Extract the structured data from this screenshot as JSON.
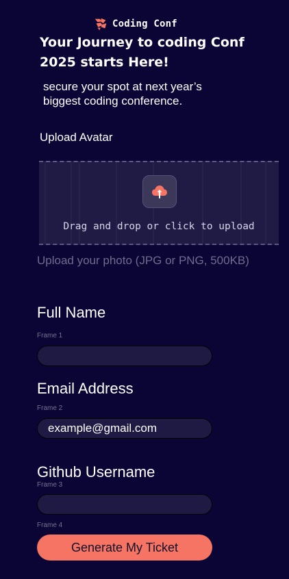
{
  "brand": {
    "logo_icon": "coding-conf-logo-icon",
    "name": "Coding Conf"
  },
  "hero": {
    "headline_line1": "Your Journey to coding Conf",
    "headline_line2": "2025 starts Here!",
    "subheadline_line1": "secure your spot at next year’s",
    "subheadline_line2": "biggest coding conference."
  },
  "upload": {
    "label": "Upload Avatar",
    "icon": "cloud-upload-icon",
    "prompt": "Drag and drop or click to upload",
    "hint": "Upload your photo (JPG or PNG, 500KB)"
  },
  "form": {
    "full_name": {
      "label": "Full Name",
      "frame": "Frame 1",
      "value": ""
    },
    "email": {
      "label": "Email Address",
      "frame": "Frame 2",
      "placeholder": "example@gmail.com"
    },
    "github": {
      "label": "Github Username",
      "frame": "Frame 3",
      "value": ""
    },
    "submit": {
      "frame": "Frame 4",
      "label": "Generate My Ticket"
    }
  },
  "colors": {
    "background": "#0a0535",
    "accent": "#f57463",
    "input_background": "#1e1a44",
    "muted_text": "#6f6c8e"
  }
}
